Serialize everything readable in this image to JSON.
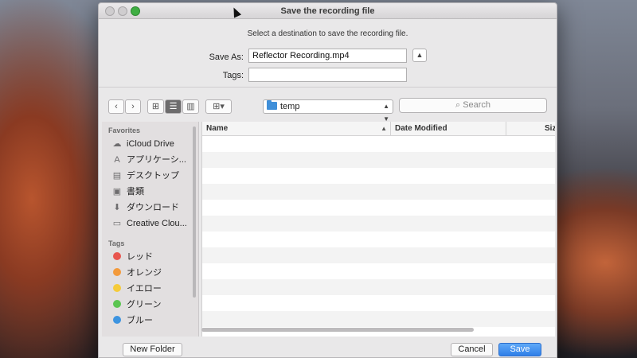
{
  "dialog": {
    "title": "Save the recording file",
    "message": "Select a destination to save the recording file.",
    "save_as_label": "Save As:",
    "save_as_value": "Reflector Recording.mp4",
    "tags_label": "Tags:",
    "tags_value": ""
  },
  "toolbar": {
    "back_glyph": "‹",
    "forward_glyph": "›",
    "current_folder": "temp",
    "search_placeholder": "Search"
  },
  "sidebar": {
    "favorites_header": "Favorites",
    "favorites": [
      {
        "label": "iCloud Drive",
        "icon": "cloud-icon"
      },
      {
        "label": "アプリケーシ...",
        "icon": "applications-icon"
      },
      {
        "label": "デスクトップ",
        "icon": "desktop-icon"
      },
      {
        "label": "書類",
        "icon": "documents-icon"
      },
      {
        "label": "ダウンロード",
        "icon": "download-icon"
      },
      {
        "label": "Creative Clou...",
        "icon": "folder-icon"
      }
    ],
    "tags_header": "Tags",
    "tags": [
      {
        "label": "レッド",
        "color": "#e8554e"
      },
      {
        "label": "オレンジ",
        "color": "#f39a3b"
      },
      {
        "label": "イエロー",
        "color": "#f5cb3a"
      },
      {
        "label": "グリーン",
        "color": "#5bc551"
      },
      {
        "label": "ブルー",
        "color": "#3d94e0"
      }
    ]
  },
  "filelist": {
    "columns": [
      "Name",
      "Date Modified",
      "Siz"
    ]
  },
  "buttons": {
    "new_folder": "New Folder",
    "cancel": "Cancel",
    "save": "Save"
  },
  "colors": {
    "accent": "#2f7fe8"
  }
}
